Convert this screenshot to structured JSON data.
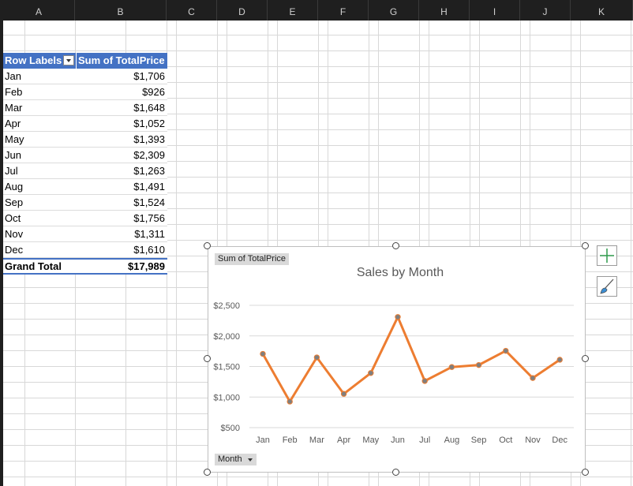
{
  "columns": [
    "A",
    "B",
    "C",
    "D",
    "E",
    "F",
    "G",
    "H",
    "I",
    "J",
    "K"
  ],
  "pivot": {
    "header_label": "Row Labels",
    "header_value": "Sum of TotalPrice",
    "rows": [
      {
        "label": "Jan",
        "value": "$1,706"
      },
      {
        "label": "Feb",
        "value": "$926"
      },
      {
        "label": "Mar",
        "value": "$1,648"
      },
      {
        "label": "Apr",
        "value": "$1,052"
      },
      {
        "label": "May",
        "value": "$1,393"
      },
      {
        "label": "Jun",
        "value": "$2,309"
      },
      {
        "label": "Jul",
        "value": "$1,263"
      },
      {
        "label": "Aug",
        "value": "$1,491"
      },
      {
        "label": "Sep",
        "value": "$1,524"
      },
      {
        "label": "Oct",
        "value": "$1,756"
      },
      {
        "label": "Nov",
        "value": "$1,311"
      },
      {
        "label": "Dec",
        "value": "$1,610"
      }
    ],
    "total_label": "Grand Total",
    "total_value": "$17,989"
  },
  "chart": {
    "value_field_button": "Sum of TotalPrice",
    "axis_field_button": "Month",
    "add_element_icon": "plus-icon",
    "style_icon": "brush-icon"
  },
  "colors": {
    "line": "#ed7d31",
    "marker": "#7f7f7f",
    "pivot_header": "#4472c4"
  },
  "chart_data": {
    "type": "line",
    "title": "Sales by Month",
    "categories": [
      "Jan",
      "Feb",
      "Mar",
      "Apr",
      "May",
      "Jun",
      "Jul",
      "Aug",
      "Sep",
      "Oct",
      "Nov",
      "Dec"
    ],
    "values": [
      1706,
      926,
      1648,
      1052,
      1393,
      2309,
      1263,
      1491,
      1524,
      1756,
      1311,
      1610
    ],
    "y_ticks": [
      "$500",
      "$1,000",
      "$1,500",
      "$2,000",
      "$2,500"
    ],
    "ylim": [
      500,
      2500
    ],
    "grid": true,
    "legend": "none"
  }
}
